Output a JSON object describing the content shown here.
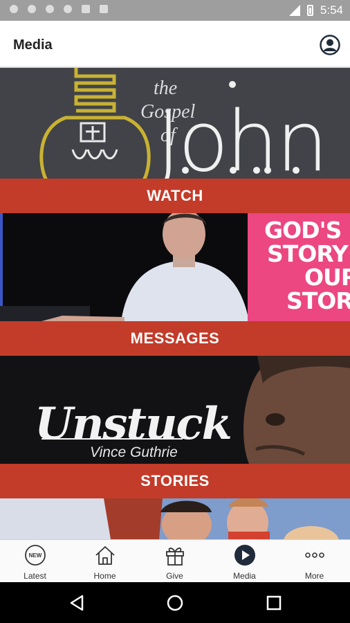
{
  "status_bar": {
    "time": "5:54"
  },
  "app_bar": {
    "title": "Media"
  },
  "tiles": {
    "john": {
      "art_line1": "the",
      "art_line2": "Gospel",
      "art_line3": "of",
      "art_title": "John",
      "banner": "WATCH"
    },
    "messages": {
      "art_text": [
        "GOD'S",
        "STORY",
        "OUR",
        "STORY"
      ],
      "banner": "MESSAGES"
    },
    "stories": {
      "art_title": "Unstuck",
      "art_subtitle": "Vince Guthrie",
      "banner": "STORIES"
    }
  },
  "bottom_nav": {
    "items": [
      {
        "label": "Latest",
        "icon": "new-badge-icon"
      },
      {
        "label": "Home",
        "icon": "home-icon"
      },
      {
        "label": "Give",
        "icon": "gift-icon"
      },
      {
        "label": "Media",
        "icon": "play-icon",
        "active": true
      },
      {
        "label": "More",
        "icon": "more-dots-icon"
      }
    ]
  },
  "colors": {
    "banner": "#c33b29",
    "status_bar": "#9e9e9e",
    "active_icon": "#1f2b3a"
  }
}
